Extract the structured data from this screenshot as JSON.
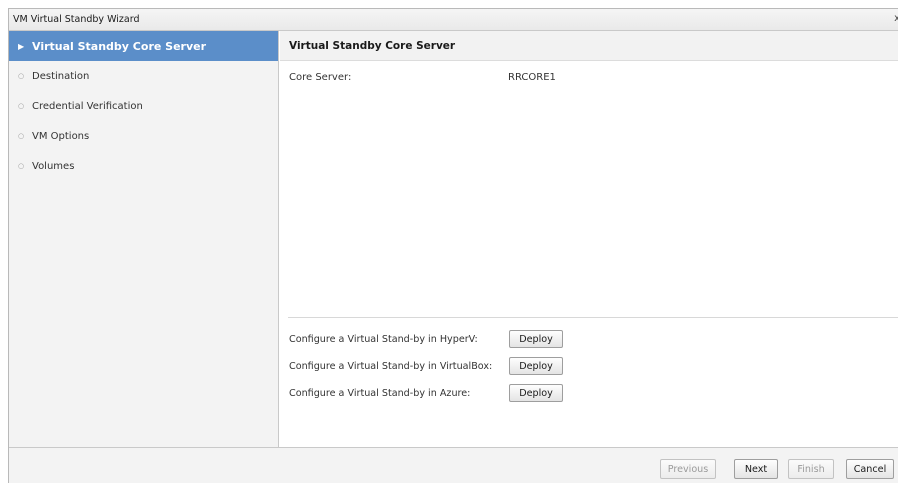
{
  "window": {
    "title": "VM Virtual Standby Wizard",
    "close_glyph": "x"
  },
  "sidebar": {
    "steps": [
      {
        "label": "Virtual Standby Core Server",
        "active": true,
        "marker": "▶"
      },
      {
        "label": "Destination",
        "active": false,
        "marker": "○"
      },
      {
        "label": "Credential Verification",
        "active": false,
        "marker": "○"
      },
      {
        "label": "VM Options",
        "active": false,
        "marker": "○"
      },
      {
        "label": "Volumes",
        "active": false,
        "marker": "○"
      }
    ]
  },
  "content": {
    "header": "Virtual Standby Core Server",
    "core_server": {
      "label": "Core Server:",
      "value": "RRCORE1"
    },
    "deploy_options": [
      {
        "label": "Configure a Virtual Stand-by in HyperV:",
        "button": "Deploy"
      },
      {
        "label": "Configure a Virtual Stand-by in VirtualBox:",
        "button": "Deploy"
      },
      {
        "label": "Configure a Virtual Stand-by in Azure:",
        "button": "Deploy"
      }
    ]
  },
  "footer": {
    "previous": "Previous",
    "next": "Next",
    "finish": "Finish",
    "cancel": "Cancel"
  },
  "colors": {
    "active_step": "#5b8ec9",
    "sidebar_bg": "#f3f3f3"
  }
}
